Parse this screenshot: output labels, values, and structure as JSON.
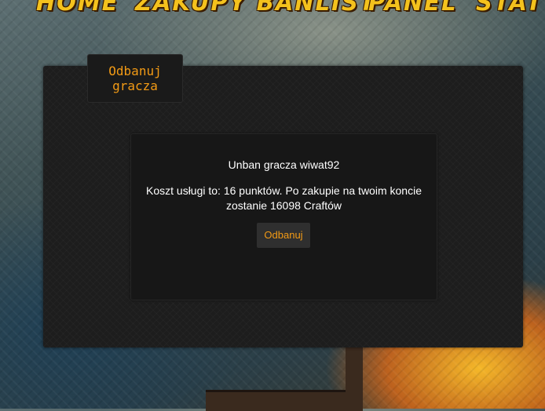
{
  "nav": {
    "items": [
      "HOME",
      "ZAKUPY BANLIST",
      "PANEL",
      "STATY"
    ]
  },
  "tab": {
    "label_line1": "Odbanuj",
    "label_line2": "gracza"
  },
  "card": {
    "title": "Unban gracza wiwat92",
    "description": "Koszt usługi to: 16 punktów. Po zakupie na twoim koncie zostanie 16098 Craftów",
    "button_label": "Odbanuj"
  },
  "colors": {
    "accent_orange": "#f29a15",
    "nav_yellow": "#f4c21d",
    "panel_bg": "#1d1d1d",
    "card_bg": "#171717"
  }
}
